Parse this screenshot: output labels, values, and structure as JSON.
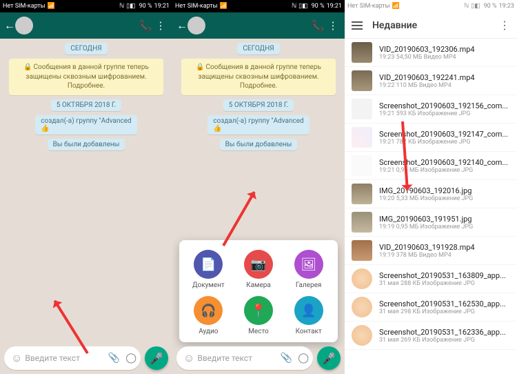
{
  "status": {
    "carrier": "Нет SIM-карты",
    "battery": "90 %",
    "time1": "19:21",
    "time2": "19:23"
  },
  "chat": {
    "today": "СЕГОДНЯ",
    "encryption": "Сообщения в данной группе теперь защищены сквозным шифрованием. Подробнее.",
    "date": "5 ОКТЯБРЯ 2018 Г.",
    "created": "создал(-а) группу \"Advanced",
    "thumbs": "👍",
    "added": "Вы были добавлены",
    "input_placeholder": "Введите текст"
  },
  "attach": {
    "document": "Документ",
    "camera": "Камера",
    "gallery": "Галерея",
    "audio": "Аудио",
    "location": "Место",
    "contact": "Контакт"
  },
  "files": {
    "title": "Недавние",
    "items": [
      {
        "name": "VID_20190603_192306.mp4",
        "meta": "19:23  54,50 МБ  Видео MP4",
        "thumb": "v1"
      },
      {
        "name": "VID_20190603_192241.mp4",
        "meta": "19:22  110 МБ  Видео MP4",
        "thumb": "v2"
      },
      {
        "name": "Screenshot_20190603_192156_com...",
        "meta": "19:21  593 КБ  Изображение JPG",
        "thumb": "s1"
      },
      {
        "name": "Screenshot_20190603_192147_com...",
        "meta": "19:21  782 КБ  Изображение JPG",
        "thumb": "s2"
      },
      {
        "name": "Screenshot_20190603_192140_com...",
        "meta": "19:21  0,95 МБ  Изображение JPG",
        "thumb": "s3"
      },
      {
        "name": "IMG_20190603_192016.jpg",
        "meta": "19:20  5,33 МБ  Изображение JPG",
        "thumb": "i1"
      },
      {
        "name": "IMG_20190603_191951.jpg",
        "meta": "19:19  0,95 МБ  Изображение JPG",
        "thumb": "i2"
      },
      {
        "name": "VID_20190603_191928.mp4",
        "meta": "19:19  378 МБ  Видео MP4",
        "thumb": "v3"
      },
      {
        "name": "Screenshot_20190531_163809_app...",
        "meta": "31 мая  288 КБ  Изображение JPG",
        "thumb": "e1"
      },
      {
        "name": "Screenshot_20190531_162530_app...",
        "meta": "31 мая  298 КБ  Изображение JPG",
        "thumb": "e2"
      },
      {
        "name": "Screenshot_20190531_162336_app...",
        "meta": "31 мая  269 КБ  Изображение JPG",
        "thumb": "e3"
      }
    ]
  }
}
